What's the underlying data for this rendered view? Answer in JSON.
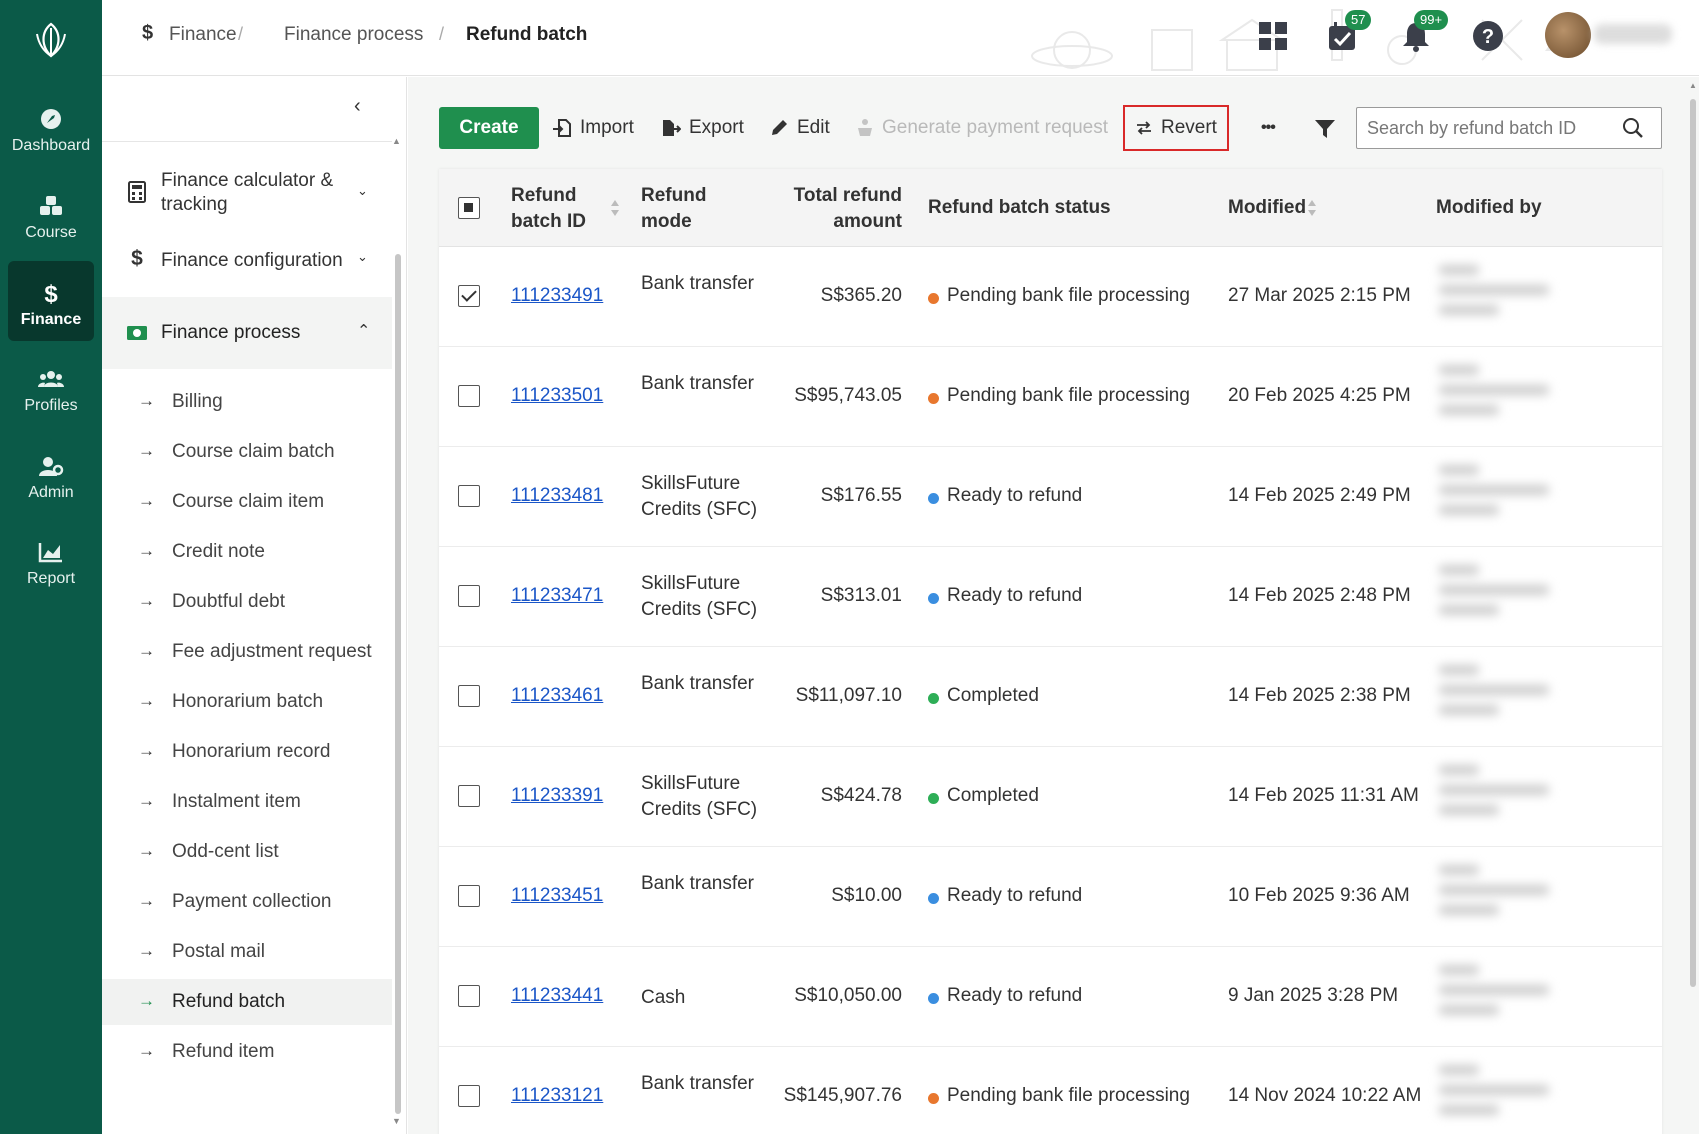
{
  "leftnav": {
    "items": [
      {
        "label": "Dashboard",
        "icon": "dashboard-icon"
      },
      {
        "label": "Course",
        "icon": "course-icon"
      },
      {
        "label": "Finance",
        "icon": "dollar-icon",
        "active": true
      },
      {
        "label": "Profiles",
        "icon": "profiles-icon"
      },
      {
        "label": "Admin",
        "icon": "admin-icon"
      },
      {
        "label": "Report",
        "icon": "report-icon"
      }
    ]
  },
  "breadcrumb": {
    "items": [
      "Finance",
      "Finance process",
      "Refund batch"
    ]
  },
  "topbar": {
    "tasks_badge": "57",
    "notifications_badge": "99+"
  },
  "sidebar": {
    "groups": [
      {
        "label": "Finance calculator & tracking",
        "expanded": false
      },
      {
        "label": "Finance configuration",
        "expanded": false
      },
      {
        "label": "Finance process",
        "expanded": true
      }
    ],
    "subitems": [
      "Billing",
      "Course claim batch",
      "Course claim item",
      "Credit note",
      "Doubtful debt",
      "Fee adjustment request",
      "Honorarium batch",
      "Honorarium record",
      "Instalment item",
      "Odd-cent list",
      "Payment collection",
      "Postal mail",
      "Refund batch",
      "Refund item"
    ],
    "selected": "Refund batch"
  },
  "toolbar": {
    "create": "Create",
    "import": "Import",
    "export": "Export",
    "edit": "Edit",
    "generate": "Generate payment request",
    "revert": "Revert",
    "more": "•••",
    "search_placeholder": "Search by refund batch ID"
  },
  "table": {
    "headers": {
      "id": "Refund batch ID",
      "mode": "Refund mode",
      "amount": "Total refund amount",
      "status": "Refund batch status",
      "modified": "Modified",
      "modified_by": "Modified by"
    },
    "status_colors": {
      "Pending bank file processing": "#e8772e",
      "Ready to refund": "#3a8ee0",
      "Completed": "#2eae57"
    },
    "rows": [
      {
        "checked": true,
        "id": "111233491",
        "mode": "Bank transfer",
        "amount": "S$365.20",
        "status": "Pending bank file processing",
        "modified": "27 Mar 2025 2:15 PM"
      },
      {
        "checked": false,
        "id": "111233501",
        "mode": "Bank transfer",
        "amount": "S$95,743.05",
        "status": "Pending bank file processing",
        "modified": "20 Feb 2025 4:25 PM"
      },
      {
        "checked": false,
        "id": "111233481",
        "mode": "SkillsFuture Credits (SFC)",
        "amount": "S$176.55",
        "status": "Ready to refund",
        "modified": "14 Feb 2025 2:49 PM"
      },
      {
        "checked": false,
        "id": "111233471",
        "mode": "SkillsFuture Credits (SFC)",
        "amount": "S$313.01",
        "status": "Ready to refund",
        "modified": "14 Feb 2025 2:48 PM"
      },
      {
        "checked": false,
        "id": "111233461",
        "mode": "Bank transfer",
        "amount": "S$11,097.10",
        "status": "Completed",
        "modified": "14 Feb 2025 2:38 PM"
      },
      {
        "checked": false,
        "id": "111233391",
        "mode": "SkillsFuture Credits (SFC)",
        "amount": "S$424.78",
        "status": "Completed",
        "modified": "14 Feb 2025 11:31 AM"
      },
      {
        "checked": false,
        "id": "111233451",
        "mode": "Bank transfer",
        "amount": "S$10.00",
        "status": "Ready to refund",
        "modified": "10 Feb 2025 9:36 AM"
      },
      {
        "checked": false,
        "id": "111233441",
        "mode": "Cash",
        "amount": "S$10,050.00",
        "status": "Ready to refund",
        "modified": "9 Jan 2025 3:28 PM"
      },
      {
        "checked": false,
        "id": "111233121",
        "mode": "Bank transfer",
        "amount": "S$145,907.76",
        "status": "Pending bank file processing",
        "modified": "14 Nov 2024 10:22 AM"
      }
    ]
  }
}
